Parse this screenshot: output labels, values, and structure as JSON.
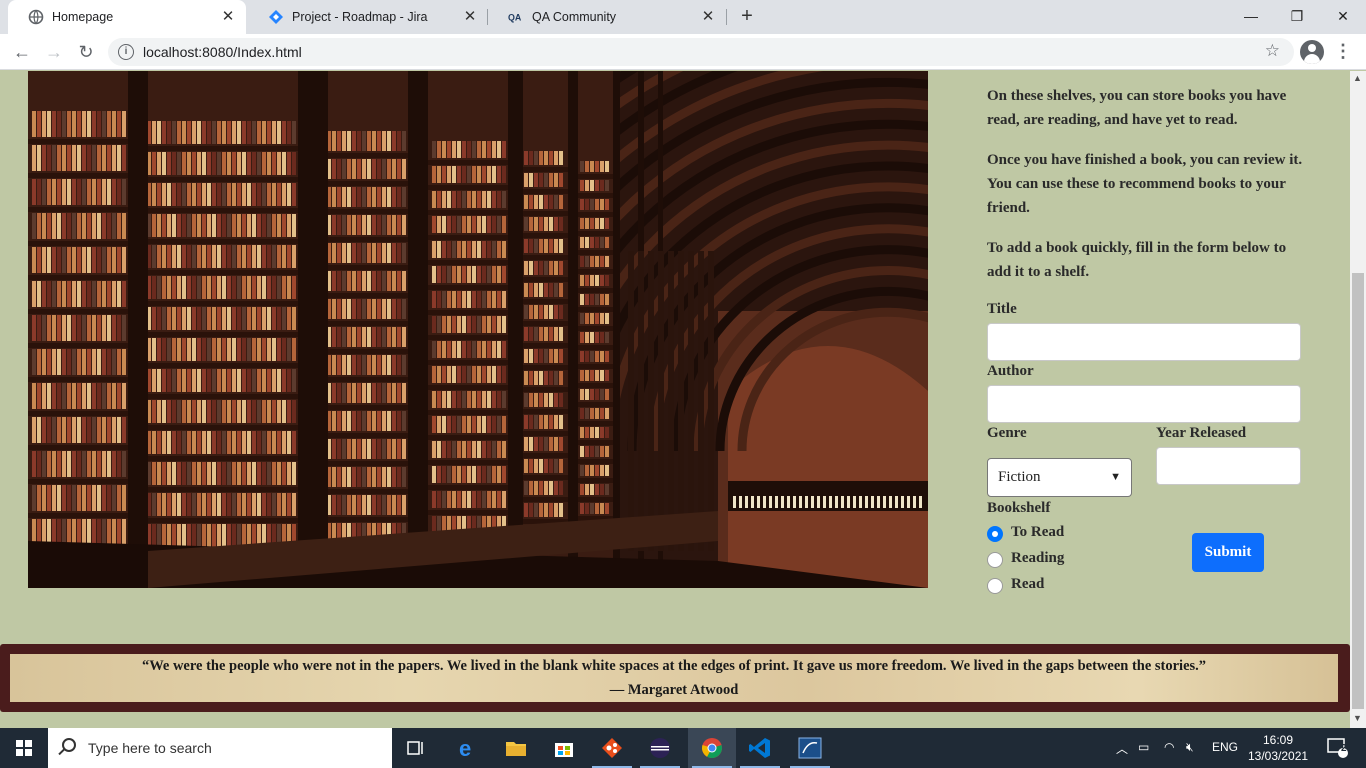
{
  "browser": {
    "tabs": [
      {
        "title": "Homepage",
        "icon": "globe-icon",
        "active": true
      },
      {
        "title": "Project - Roadmap - Jira",
        "icon": "jira-icon",
        "active": false
      },
      {
        "title": "QA Community",
        "icon": "qa-icon",
        "active": false
      }
    ],
    "url": "localhost:8080/Index.html"
  },
  "intro": {
    "p1": "On these shelves, you can store books you have read, are reading, and have yet to read.",
    "p2": "Once you have finished a book, you can review it. You can use these to recommend books to your friend.",
    "p3": "To add a book quickly, fill in the form below to add it to a shelf."
  },
  "form": {
    "title_label": "Title",
    "title_value": "",
    "author_label": "Author",
    "author_value": "",
    "genre_label": "Genre",
    "genre_selected": "Fiction",
    "year_label": "Year Released",
    "year_value": "",
    "bookshelf_label": "Bookshelf",
    "shelves": [
      {
        "label": "To Read",
        "checked": true
      },
      {
        "label": "Reading",
        "checked": false
      },
      {
        "label": "Read",
        "checked": false
      }
    ],
    "submit_label": "Submit"
  },
  "quote": {
    "text": "“We were the people who were not in the papers. We lived in the blank white spaces at the edges of print. It gave us more freedom. We lived in the gaps between the stories.”",
    "author": "— Margaret Atwood"
  },
  "taskbar": {
    "search_placeholder": "Type here to search",
    "language": "ENG",
    "time": "16:09",
    "date": "13/03/2021",
    "notifications": "2"
  },
  "colors": {
    "page_bg": "#bfc8a4",
    "quote_border": "#4a1c1c",
    "submit_bg": "#0d6efd",
    "radio_checked": "#0075ff"
  }
}
